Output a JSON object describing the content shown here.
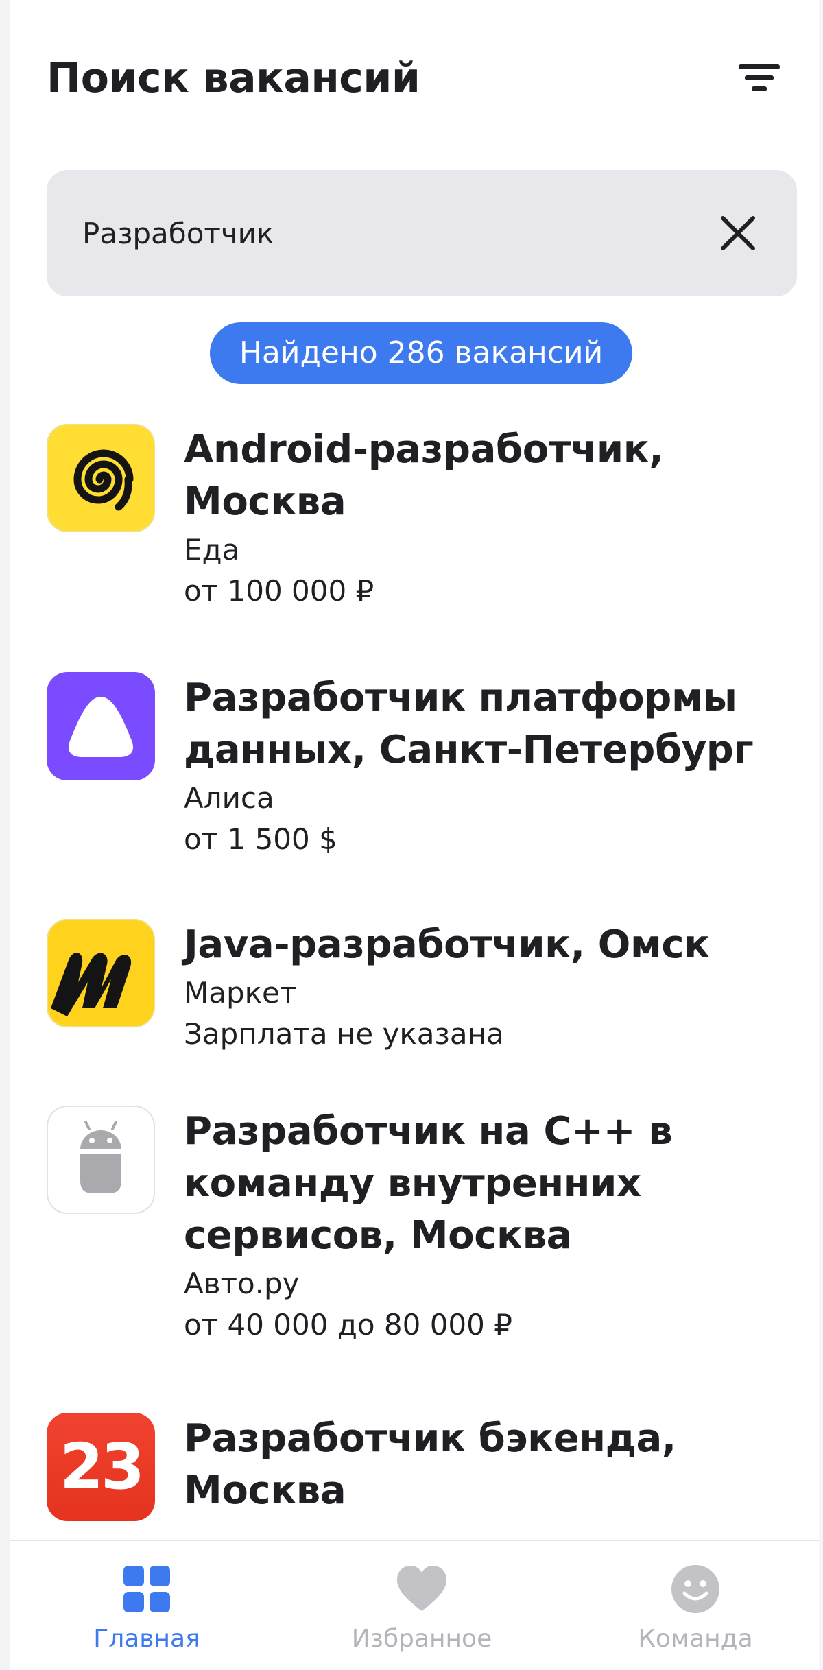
{
  "header": {
    "title": "Поиск вакансий",
    "filter_icon": "filter-icon"
  },
  "search": {
    "value": "Разработчик",
    "clear_icon": "close-icon"
  },
  "results": {
    "label": "Найдено 286 вакансий"
  },
  "vacancies": [
    {
      "title": "Android-разработчик, Москва",
      "company": "Еда",
      "salary": "от 100 000 ₽",
      "logo": "eda-logo"
    },
    {
      "title": "Разработчик платформы данных, Санкт-Петербург",
      "company": "Алиса",
      "salary": "от 1 500 $",
      "logo": "alisa-logo"
    },
    {
      "title": "Java-разработчик, Омск",
      "company": "Маркет",
      "salary": "Зарплата не указана",
      "logo": "market-logo"
    },
    {
      "title": "Разработчик на С++ в команду внутренних сервисов, Москва",
      "company": "Авто.ру",
      "salary": "от 40 000 до 80 000 ₽",
      "logo": "android-robot-logo"
    },
    {
      "title": "Разработчик бэкенда, Москва",
      "company": "",
      "salary": "",
      "logo": "23-logo",
      "logo_text": "23"
    }
  ],
  "nav": {
    "items": [
      {
        "label": "Главная",
        "icon": "grid-icon",
        "active": true
      },
      {
        "label": "Избранное",
        "icon": "heart-icon",
        "active": false
      },
      {
        "label": "Команда",
        "icon": "smiley-icon",
        "active": false
      }
    ]
  },
  "colors": {
    "accent": "#3d79ef",
    "search_bg": "#e8e8ec",
    "text": "#1f1f24",
    "inactive": "#b4b4ba",
    "eda_yellow": "#ffdd33",
    "alisa_purple": "#7b4cff",
    "logo_red": "#ef3b2d"
  }
}
